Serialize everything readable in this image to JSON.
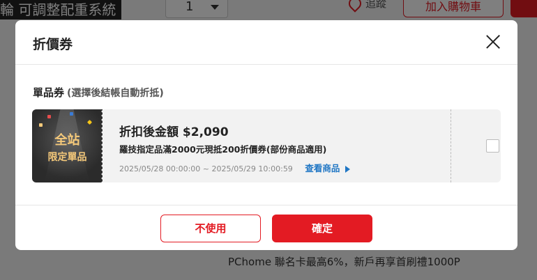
{
  "background": {
    "product_title": "輪 可調整配重系統",
    "quantity": "1",
    "track_label": "追蹤",
    "add_to_cart_label": "加入購物車",
    "promo_text": "PChome 聯名卡最高6%，新戶再享首刷禮1000P"
  },
  "modal": {
    "title": "折價券",
    "section": {
      "title": "單品券",
      "note": "(選擇後結帳自動折抵)"
    },
    "coupon": {
      "badge_line1": "全站",
      "badge_line2": "限定單品",
      "amount_text": "折扣後金額 $2,090",
      "description": "羅技指定品滿2000元現抵200折價券(部份商品適用)",
      "validity": "2025/05/28 00:00:00 ~ 2025/05/29 10:00:59",
      "view_link": "查看商品",
      "checked": false
    },
    "buttons": {
      "cancel": "不使用",
      "confirm": "確定"
    }
  },
  "colors": {
    "brand_red": "#e31b23",
    "link_blue": "#1f76c4",
    "badge_gold": "#f5c97a"
  }
}
